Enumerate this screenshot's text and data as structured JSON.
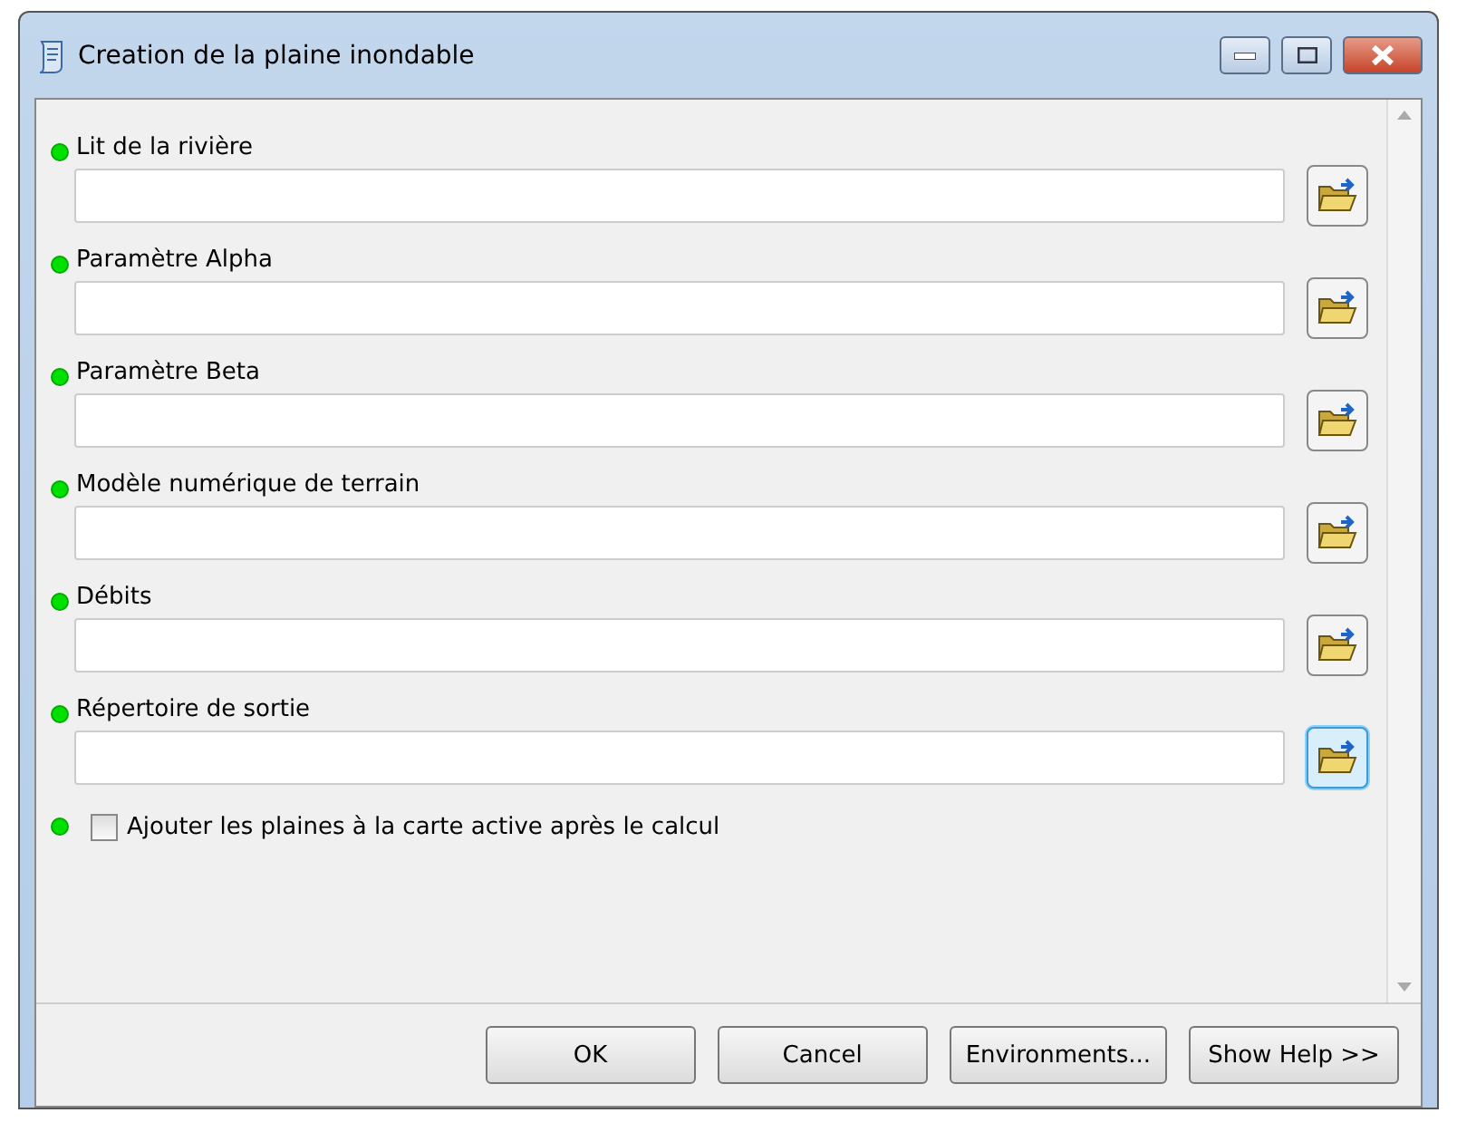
{
  "window": {
    "title": "Creation de la plaine inondable"
  },
  "parameters": [
    {
      "label": "Lit de la rivière",
      "focused": false
    },
    {
      "label": "Paramètre Alpha",
      "focused": false
    },
    {
      "label": "Paramètre Beta",
      "focused": false
    },
    {
      "label": "Modèle numérique de terrain",
      "focused": false
    },
    {
      "label": "Débits",
      "focused": false
    },
    {
      "label": "Répertoire de sortie",
      "focused": true
    }
  ],
  "option": {
    "label": "Ajouter les plaines à la carte active après le calcul",
    "checked": false
  },
  "buttons": [
    "OK",
    "Cancel",
    "Environments...",
    "Show Help >>"
  ]
}
